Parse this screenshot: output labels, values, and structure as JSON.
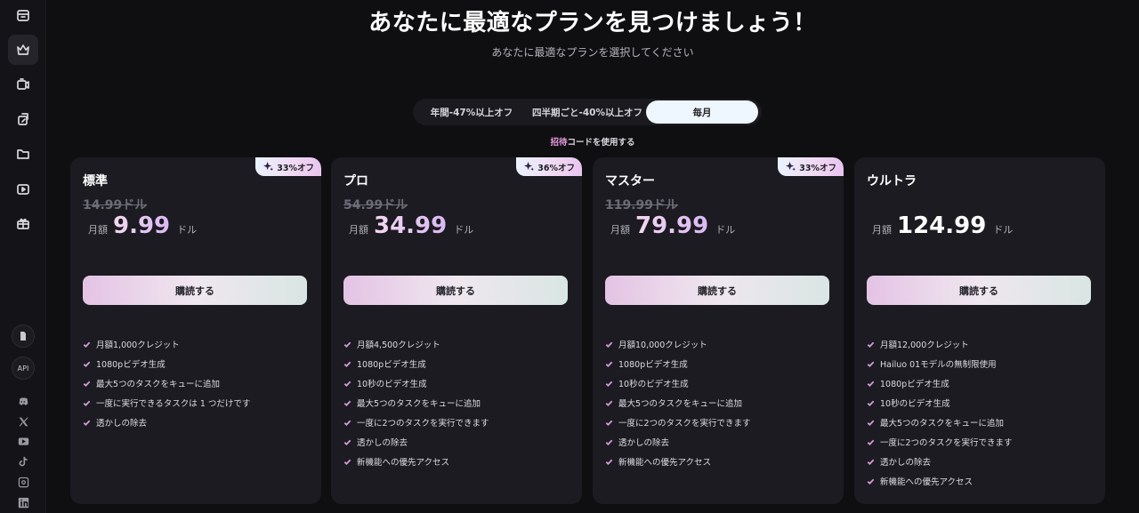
{
  "header": {
    "title": "あなたに最適なプランを見つけましょう！",
    "subtitle": "あなたに最適なプランを選択してください"
  },
  "billing_toggle": {
    "options": [
      "年間-47%以上オフ",
      "四半期ごと-40%以上オフ",
      "毎月"
    ],
    "selected": "毎月"
  },
  "invite": {
    "highlight": "招待",
    "rest": "コードを使用する"
  },
  "sidebar": {
    "icons": [
      "calendar-icon",
      "crown-icon",
      "video-add-icon",
      "swap-icon",
      "folder-icon",
      "video-play-icon",
      "gift-icon"
    ],
    "api_label": "API",
    "socials": [
      "discord-icon",
      "x-icon",
      "youtube-icon",
      "tiktok-icon",
      "instagram-icon",
      "linkedin-icon"
    ]
  },
  "plans": [
    {
      "name": "標準",
      "badge": "33%オフ",
      "old_price": "14.99ドル",
      "price_prefix": "月額",
      "price": "9.99",
      "price_suffix": "ドル",
      "cta": "購読する",
      "features": [
        "月額1,000クレジット",
        "1080pビデオ生成",
        "最大5つのタスクをキューに追加",
        "一度に実行できるタスクは 1 つだけです",
        "透かしの除去"
      ]
    },
    {
      "name": "プロ",
      "badge": "36%オフ",
      "old_price": "54.99ドル",
      "price_prefix": "月額",
      "price": "34.99",
      "price_suffix": "ドル",
      "cta": "購読する",
      "features": [
        "月額4,500クレジット",
        "1080pビデオ生成",
        "10秒のビデオ生成",
        "最大5つのタスクをキューに追加",
        "一度に2つのタスクを実行できます",
        "透かしの除去",
        "新機能への優先アクセス"
      ]
    },
    {
      "name": "マスター",
      "badge": "33%オフ",
      "old_price": "119.99ドル",
      "price_prefix": "月額",
      "price": "79.99",
      "price_suffix": "ドル",
      "cta": "購読する",
      "features": [
        "月額10,000クレジット",
        "1080pビデオ生成",
        "10秒のビデオ生成",
        "最大5つのタスクをキューに追加",
        "一度に2つのタスクを実行できます",
        "透かしの除去",
        "新機能への優先アクセス"
      ]
    },
    {
      "name": "ウルトラ",
      "badge": "",
      "old_price": "",
      "price_prefix": "月額",
      "price": "124.99",
      "price_suffix": "ドル",
      "cta": "購読する",
      "features": [
        "月額12,000クレジット",
        "Hailuo 01モデルの無制限使用",
        "1080pビデオ生成",
        "10秒のビデオ生成",
        "最大5つのタスクをキューに追加",
        "一度に2つのタスクを実行できます",
        "透かしの除去",
        "新機能への優先アクセス"
      ]
    }
  ],
  "colors": {
    "background": "#0f0f12",
    "card": "#1b1b21",
    "accent_pink": "#e79adf",
    "toggle_selected": "#eef6ff"
  }
}
